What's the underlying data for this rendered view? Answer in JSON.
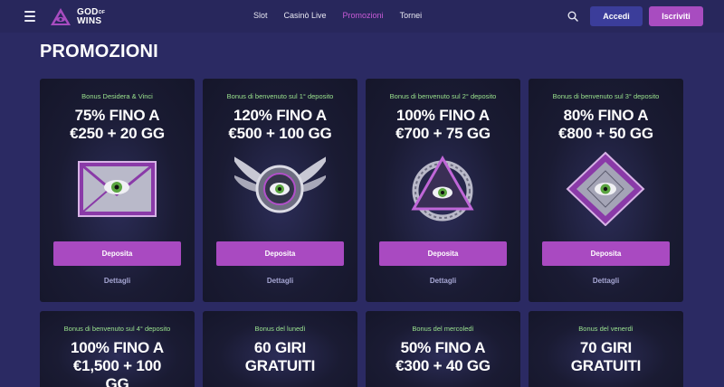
{
  "header": {
    "logo": {
      "line1": "GOD",
      "of": "OF",
      "line2": "WINS"
    },
    "nav": [
      "Slot",
      "Casinò Live",
      "Promozioni",
      "Tornei"
    ],
    "active_nav": "Promozioni",
    "login_label": "Accedi",
    "register_label": "Iscriviti"
  },
  "page": {
    "title": "PROMOZIONI"
  },
  "colors": {
    "accent": "#a94ac1",
    "subtitle": "#9be48e",
    "login": "#3b3d9a",
    "bg": "#2b2a63"
  },
  "cards": [
    {
      "subtitle": "Bonus Desidera & Vinci",
      "title1": "75% FINO A",
      "title2": "€250 + 20 GG",
      "button": "Deposita",
      "details": "Dettagli",
      "icon": "envelope-eye-icon"
    },
    {
      "subtitle": "Bonus di benvenuto sul 1° deposito",
      "title1": "120% FINO A",
      "title2": "€500 + 100 GG",
      "button": "Deposita",
      "details": "Dettagli",
      "icon": "winged-eye-icon"
    },
    {
      "subtitle": "Bonus di benvenuto sul 2° deposito",
      "title1": "100% FINO A",
      "title2": "€700 + 75 GG",
      "button": "Deposita",
      "details": "Dettagli",
      "icon": "serpent-triangle-eye-icon"
    },
    {
      "subtitle": "Bonus di benvenuto sul 3° deposito",
      "title1": "80% FINO A",
      "title2": "€800 + 50 GG",
      "button": "Deposita",
      "details": "Dettagli",
      "icon": "diamond-eye-icon"
    },
    {
      "subtitle": "Bonus di benvenuto sul 4° deposito",
      "title1": "100% FINO A",
      "title2": "€1,500 + 100",
      "title3": "GG"
    },
    {
      "subtitle": "Bonus del lunedì",
      "title1": "60 GIRI",
      "title2": "GRATUITI"
    },
    {
      "subtitle": "Bonus del mercoledì",
      "title1": "50% FINO A",
      "title2": "€300 + 40 GG"
    },
    {
      "subtitle": "Bonus del venerdì",
      "title1": "70 GIRI",
      "title2": "GRATUITI"
    }
  ]
}
